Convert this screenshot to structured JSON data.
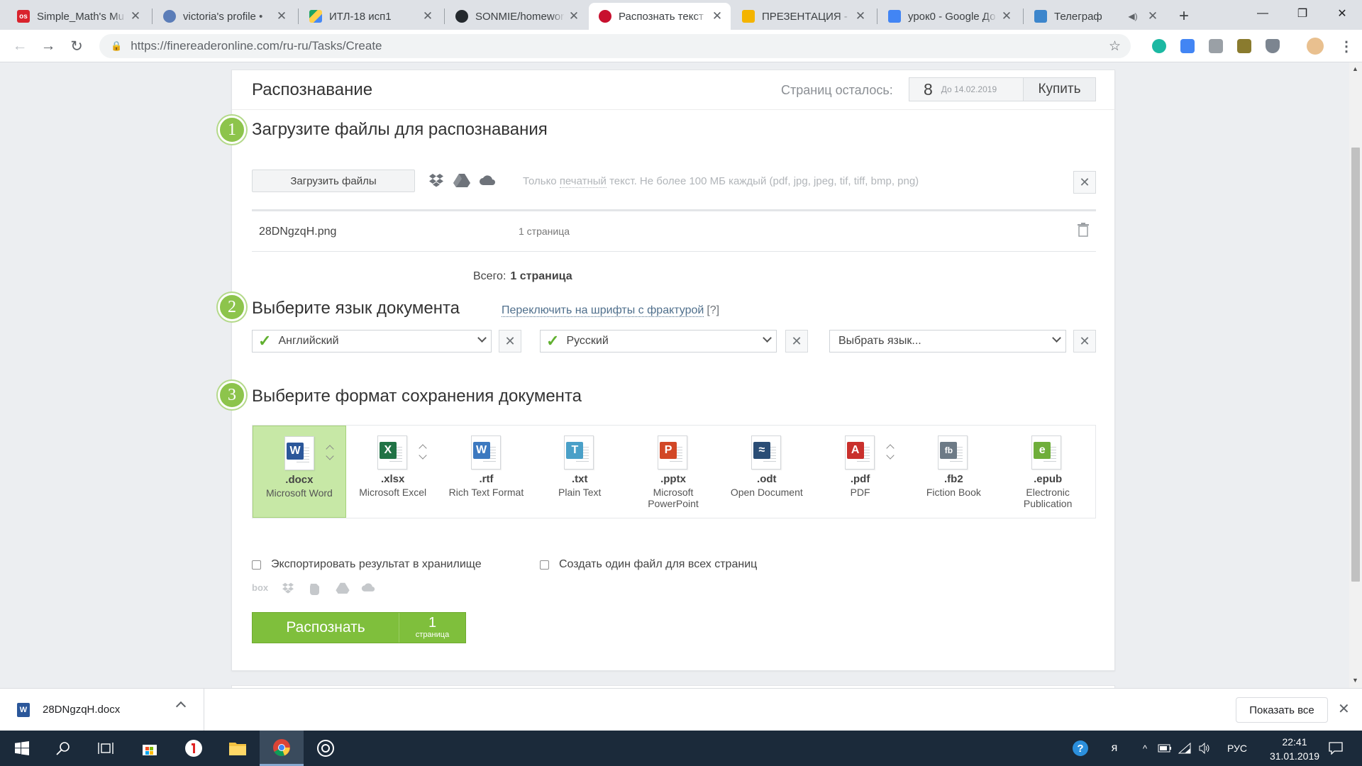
{
  "browser": {
    "tabs": [
      {
        "title": "Simple_Math's Mu",
        "favicon": "os-icon",
        "color": "#d9232d"
      },
      {
        "title": "victoria's profile • ",
        "favicon": "osu-icon",
        "color": "#5b7db8"
      },
      {
        "title": "ИТЛ-18 исп1",
        "favicon": "google-drive-icon",
        "color": "#1fa463"
      },
      {
        "title": "SONMIE/homewor",
        "favicon": "github-icon",
        "color": "#24292e"
      },
      {
        "title": "Распознать текст ",
        "favicon": "finereader-icon",
        "color": "#c8102e"
      },
      {
        "title": "ПРЕЗЕНТАЦИЯ - ",
        "favicon": "google-slides-icon",
        "color": "#f4b400"
      },
      {
        "title": "урок0 - Google До",
        "favicon": "google-docs-icon",
        "color": "#4285f4"
      },
      {
        "title": "Телеграф",
        "favicon": "telegraph-icon",
        "color": "#3d86cc"
      }
    ],
    "url": "https://finereaderonline.com/ru-ru/Tasks/Create"
  },
  "page": {
    "title": "Распознавание",
    "pages_left_label": "Страниц осталось:",
    "pages_left_count": "8",
    "pages_left_date": "До 14.02.2019",
    "buy_label": "Купить",
    "step1": {
      "number": "1",
      "title": "Загрузите файлы для распознавания",
      "upload_label": "Загрузить файлы",
      "hint_before": "Только ",
      "hint_link": "печатный",
      "hint_after": " текст. Не более 100 МБ каждый (pdf, jpg, jpeg, tif, tiff, bmp, png)"
    },
    "file": {
      "name": "28DNgzqH.png",
      "pages": "1 страница"
    },
    "total_label": "Всего:",
    "total_value": "1 страница",
    "step2": {
      "number": "2",
      "title": "Выберите язык документа",
      "fraktur_link": "Переключить на шрифты с фрактурой",
      "fraktur_help": "[?]",
      "languages": [
        "Английский",
        "Русский"
      ],
      "placeholder": "Выбрать язык..."
    },
    "step3": {
      "number": "3",
      "title": "Выберите формат сохранения документа",
      "formats": [
        {
          "ext": ".docx",
          "name": "Microsoft Word",
          "badge": "W",
          "color": "#2b579a"
        },
        {
          "ext": ".xlsx",
          "name": "Microsoft Excel",
          "badge": "X",
          "color": "#217346"
        },
        {
          "ext": ".rtf",
          "name": "Rich Text Format",
          "badge": "W",
          "color": "#3c79c0"
        },
        {
          "ext": ".txt",
          "name": "Plain Text",
          "badge": "T",
          "color": "#4aa0c8"
        },
        {
          "ext": ".pptx",
          "name": "Microsoft PowerPoint",
          "badge": "P",
          "color": "#d24726"
        },
        {
          "ext": ".odt",
          "name": "Open Document",
          "badge": "≈",
          "color": "#2a4d75"
        },
        {
          "ext": ".pdf",
          "name": "PDF",
          "badge": "A",
          "color": "#c9302c"
        },
        {
          "ext": ".fb2",
          "name": "Fiction Book",
          "badge": "fb",
          "color": "#6d7a86"
        },
        {
          "ext": ".epub",
          "name": "Electronic Publication",
          "badge": "e",
          "color": "#6fae3a"
        }
      ]
    },
    "export_label": "Экспортировать результат в хранилище",
    "single_file_label": "Создать один файл для всех страниц",
    "storage_box_label": "box",
    "recognize_label": "Распознать",
    "recognize_count": "1",
    "recognize_unit": "страница"
  },
  "downloads": {
    "file": "28DNgzqH.docx",
    "show_all": "Показать все"
  },
  "taskbar": {
    "lang": "РУС",
    "time": "22:41",
    "date": "31.01.2019"
  }
}
